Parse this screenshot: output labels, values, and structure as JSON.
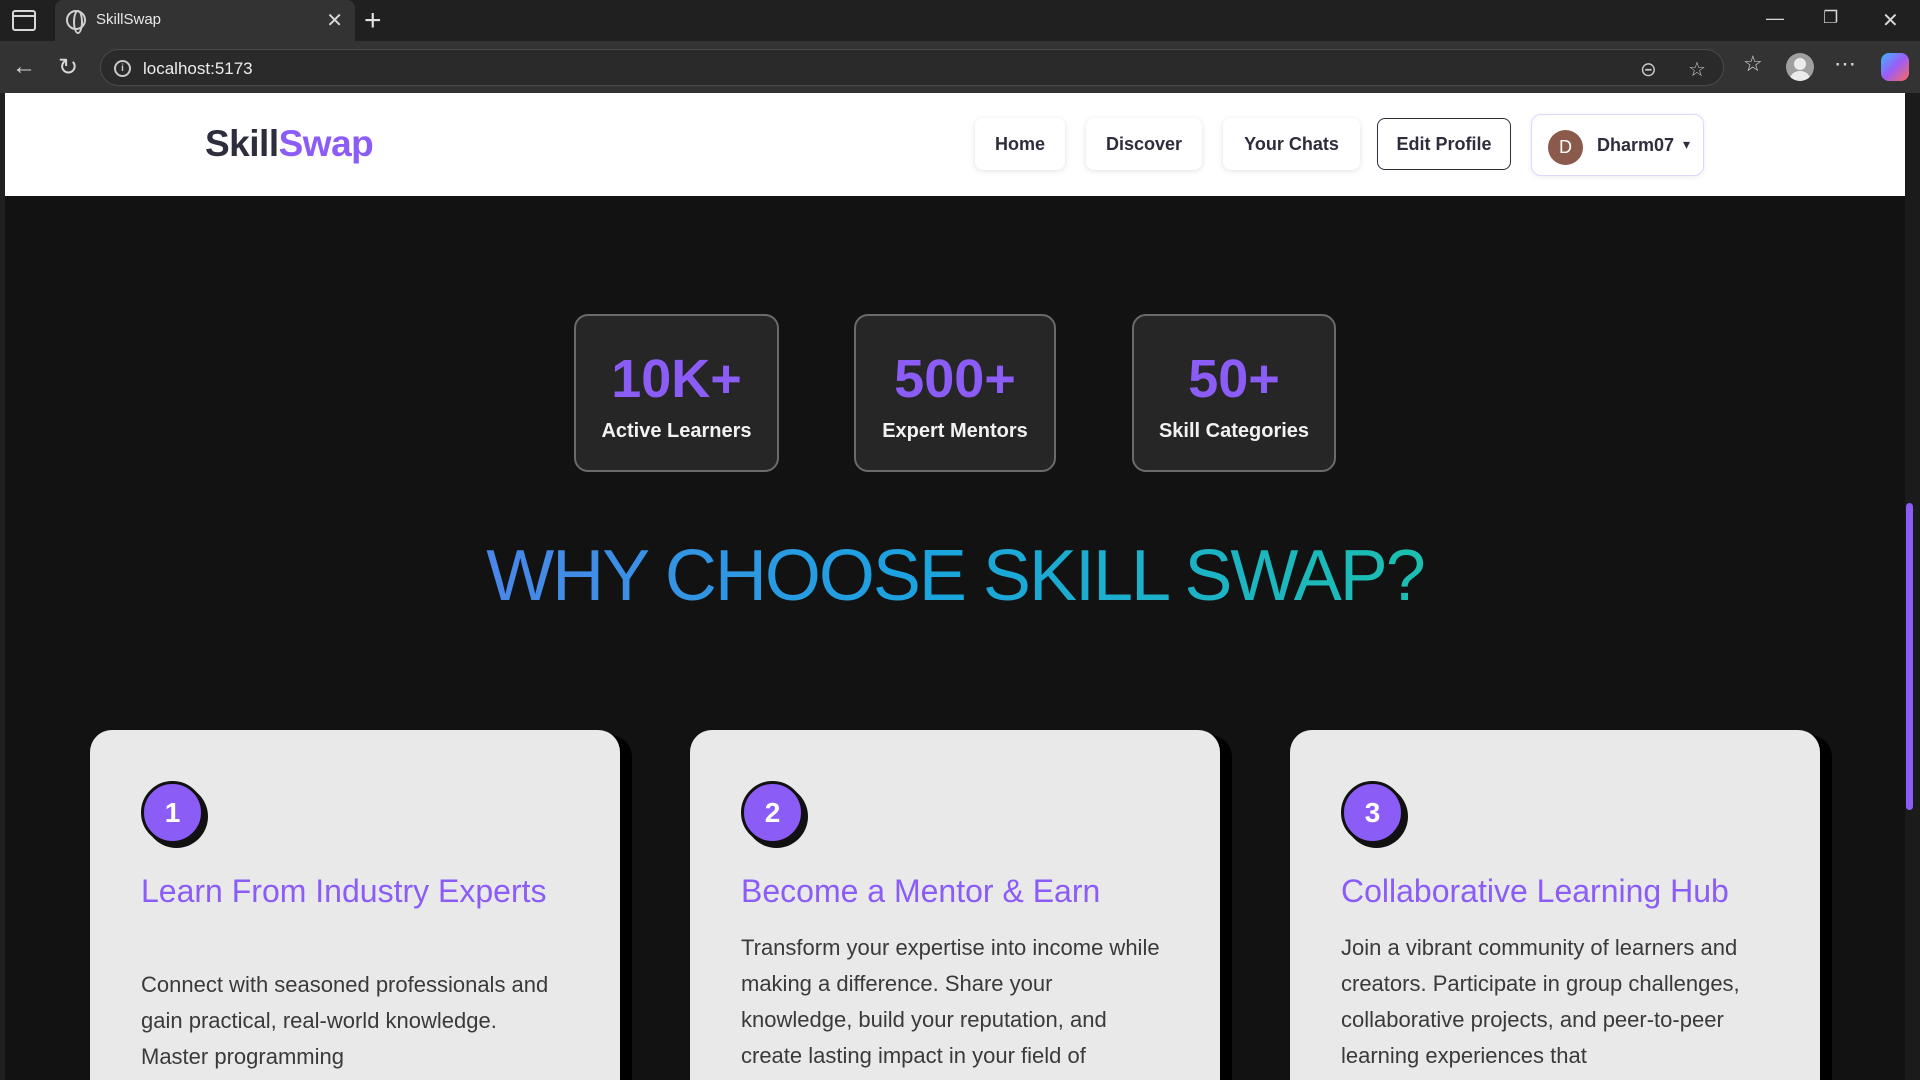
{
  "browser": {
    "tab_title": "SkillSwap",
    "url": "localhost:5173"
  },
  "navbar": {
    "logo_part1": "Skill",
    "logo_part2": "Swap",
    "links": {
      "home": "Home",
      "discover": "Discover",
      "chats": "Your Chats",
      "edit_profile": "Edit Profile"
    },
    "user": {
      "initial": "D",
      "name": "Dharm07",
      "caret": "▾"
    }
  },
  "stats": [
    {
      "value": "10K+",
      "label": "Active Learners"
    },
    {
      "value": "500+",
      "label": "Expert Mentors"
    },
    {
      "value": "50+",
      "label": "Skill Categories"
    }
  ],
  "section": {
    "heading": "WHY CHOOSE SKILL SWAP?"
  },
  "features": [
    {
      "number": "1",
      "title": "Learn From Industry Experts",
      "description": "Connect with seasoned professionals and gain practical, real-world knowledge. Master programming"
    },
    {
      "number": "2",
      "title": "Become a Mentor & Earn",
      "description": "Transform your expertise into income while making a difference. Share your knowledge, build your reputation, and create lasting impact in your field of"
    },
    {
      "number": "3",
      "title": "Collaborative Learning Hub",
      "description": "Join a vibrant community of learners and creators. Participate in group challenges, collaborative projects, and peer-to-peer learning experiences that"
    }
  ],
  "colors": {
    "accent": "#8b5cf6",
    "page_bg": "#121212",
    "card_bg": "#e9e9e9",
    "heading_gradient_start": "#4a86e8",
    "heading_gradient_end": "#1cbfb0"
  }
}
